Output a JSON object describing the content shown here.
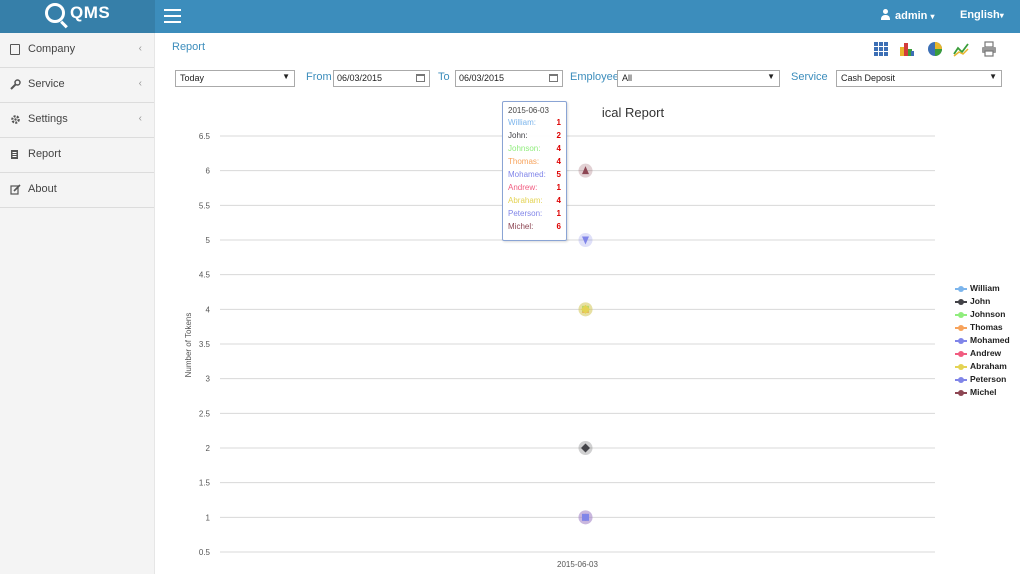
{
  "app": {
    "logo_text": "QMS"
  },
  "header": {
    "user": "admin",
    "language": "English"
  },
  "sidebar": {
    "items": [
      {
        "label": "Company",
        "icon": "building-icon",
        "has_children": true
      },
      {
        "label": "Service",
        "icon": "wrench-icon",
        "has_children": true
      },
      {
        "label": "Settings",
        "icon": "gear-icon",
        "has_children": true
      },
      {
        "label": "Report",
        "icon": "report-icon",
        "has_children": false
      },
      {
        "label": "About",
        "icon": "edit-icon",
        "has_children": false
      }
    ],
    "chevron": "‹"
  },
  "main": {
    "title": "Report",
    "view_icons": [
      "grid-view-icon",
      "bar-chart-icon",
      "pie-chart-icon",
      "line-chart-icon",
      "print-icon"
    ]
  },
  "filters": {
    "period": "Today",
    "from_label": "From",
    "from_value": "06/03/2015",
    "to_label": "To",
    "to_value": "06/03/2015",
    "employee_label": "Employee",
    "employee_value": "All",
    "service_label": "Service",
    "service_value": "Cash Deposit"
  },
  "chart_data": {
    "type": "line",
    "title_visible": "ical Report",
    "ylabel": "Number of Tokens",
    "x": [
      "2015-06-03"
    ],
    "yticks": [
      0.5,
      1,
      1.5,
      2,
      2.5,
      3,
      3.5,
      4,
      4.5,
      5,
      5.5,
      6,
      6.5
    ],
    "ylim": [
      0.5,
      6.5
    ],
    "grid": true,
    "legend_position": "right",
    "series": [
      {
        "name": "William",
        "values": [
          1
        ],
        "color": "#7cb5ec",
        "marker": "circle"
      },
      {
        "name": "John",
        "values": [
          2
        ],
        "color": "#434348",
        "marker": "diamond"
      },
      {
        "name": "Johnson",
        "values": [
          4
        ],
        "color": "#90ed7d",
        "marker": "square"
      },
      {
        "name": "Thomas",
        "values": [
          4
        ],
        "color": "#f7a35c",
        "marker": "triangle"
      },
      {
        "name": "Mohamed",
        "values": [
          5
        ],
        "color": "#8085e9",
        "marker": "triangle-down"
      },
      {
        "name": "Andrew",
        "values": [
          1
        ],
        "color": "#f15c80",
        "marker": "circle"
      },
      {
        "name": "Abraham",
        "values": [
          4
        ],
        "color": "#e4d354",
        "marker": "diamond"
      },
      {
        "name": "Peterson",
        "values": [
          1
        ],
        "color": "#8085e8",
        "marker": "square"
      },
      {
        "name": "Michel",
        "values": [
          6
        ],
        "color": "#8d4653",
        "marker": "triangle"
      }
    ]
  },
  "tooltip": {
    "date": "2015-06-03",
    "rows": [
      {
        "name": "William:",
        "value": "1",
        "color": "#7cb5ec"
      },
      {
        "name": "John:",
        "value": "2",
        "color": "#434348"
      },
      {
        "name": "Johnson:",
        "value": "4",
        "color": "#90ed7d"
      },
      {
        "name": "Thomas:",
        "value": "4",
        "color": "#f7a35c"
      },
      {
        "name": "Mohamed:",
        "value": "5",
        "color": "#8085e9"
      },
      {
        "name": "Andrew:",
        "value": "1",
        "color": "#f15c80"
      },
      {
        "name": "Abraham:",
        "value": "4",
        "color": "#e4d354"
      },
      {
        "name": "Peterson:",
        "value": "1",
        "color": "#8085e8"
      },
      {
        "name": "Michel:",
        "value": "6",
        "color": "#8d4653"
      }
    ]
  }
}
